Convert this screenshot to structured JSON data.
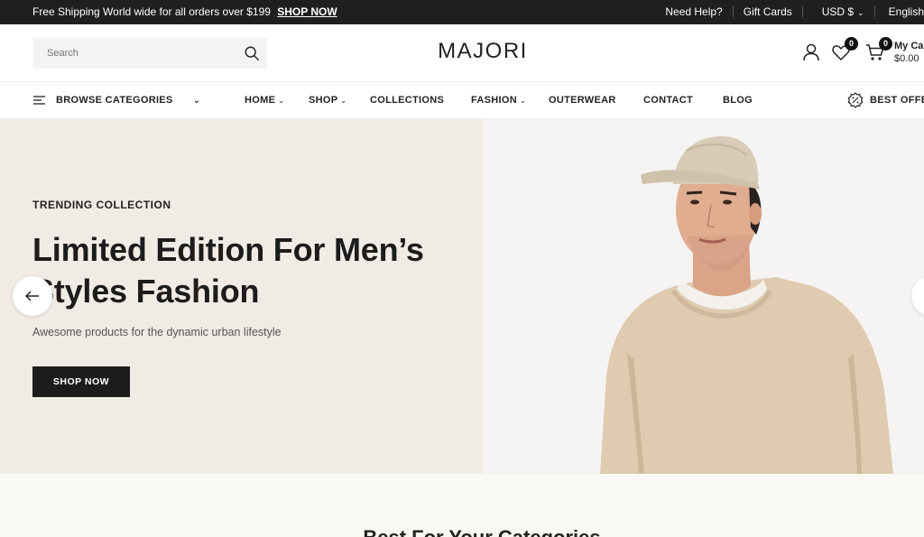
{
  "topbar": {
    "promo_text": "Free Shipping World wide for all orders over $199",
    "promo_link": "SHOP NOW",
    "help": "Need Help?",
    "gift_cards": "Gift Cards",
    "currency": "USD $",
    "language": "English"
  },
  "header": {
    "search_placeholder": "Search",
    "logo": "MAJORI",
    "wishlist_count": "0",
    "cart_count": "0",
    "cart_label": "My Cart",
    "cart_total": "$0.00"
  },
  "nav": {
    "browse": "BROWSE CATEGORIES",
    "items": [
      "HOME",
      "SHOP",
      "COLLECTIONS",
      "FASHION",
      "OUTERWEAR",
      "CONTACT",
      "BLOG"
    ],
    "offer": "BEST OFFER"
  },
  "hero": {
    "tag": "TRENDING COLLECTION",
    "title": "Limited Edition For Men’s Styles Fashion",
    "subtitle": "Awesome products for the dynamic urban lifestyle",
    "button": "SHOP NOW"
  },
  "section": {
    "title": "Best For Your Categories"
  }
}
